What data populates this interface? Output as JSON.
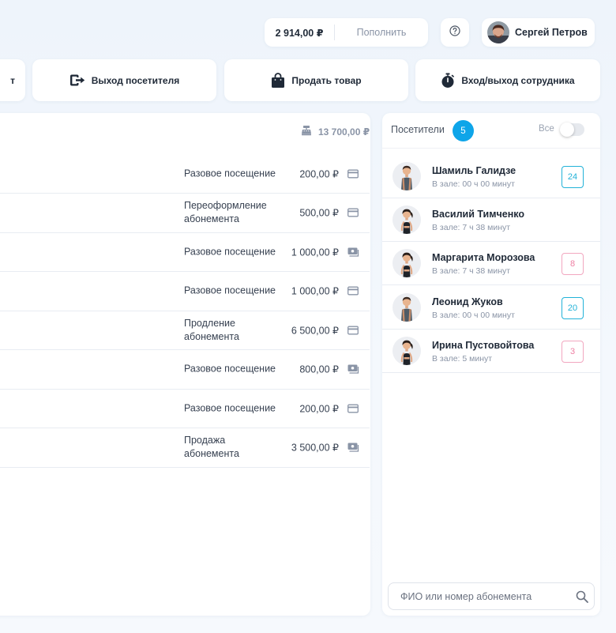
{
  "header": {
    "balance": "2 914,00 ₽",
    "topup_label": "Пополнить",
    "user_name": "Сергей Петров"
  },
  "actions": [
    {
      "label": "т",
      "icon": "partial-icon"
    },
    {
      "label": "Выход посетителя",
      "icon": "exit-icon"
    },
    {
      "label": "Продать товар",
      "icon": "shopping-bag-icon"
    },
    {
      "label": "Вход/выход сотрудника",
      "icon": "stopwatch-icon"
    }
  ],
  "transactions": {
    "total": "13 700,00 ₽",
    "total_icon": "cash-register-icon",
    "rows": [
      {
        "desc": "Разовое посещение",
        "amount": "200,00 ₽",
        "payment": "card"
      },
      {
        "desc": "Переоформление абонемента",
        "amount": "500,00 ₽",
        "payment": "card"
      },
      {
        "desc": "Разовое посещение",
        "amount": "1 000,00 ₽",
        "payment": "cash"
      },
      {
        "desc": "Разовое посещение",
        "amount": "1 000,00 ₽",
        "payment": "card"
      },
      {
        "desc": "Продление абонемента",
        "amount": "6 500,00 ₽",
        "payment": "card"
      },
      {
        "desc": "Разовое посещение",
        "amount": "800,00 ₽",
        "payment": "cash"
      },
      {
        "desc": "Разовое посещение",
        "amount": "200,00 ₽",
        "payment": "card"
      },
      {
        "desc": "Продажа абонемента",
        "amount": "3 500,00 ₽",
        "payment": "cash"
      }
    ]
  },
  "visitors": {
    "title": "Посетители",
    "count": "5",
    "filter_label": "Все",
    "filter_on": false,
    "items": [
      {
        "name": "Шамиль Галидзе",
        "time": "В зале: 00 ч 00 минут",
        "badge": "24",
        "badge_color": "blue",
        "gender": "male"
      },
      {
        "name": "Василий Тимченко",
        "time": "В зале: 7 ч 38 минут",
        "badge": "",
        "badge_color": "",
        "gender": "female"
      },
      {
        "name": "Маргарита Морозова",
        "time": "В зале: 7 ч 38 минут",
        "badge": "8",
        "badge_color": "pink",
        "gender": "female"
      },
      {
        "name": "Леонид Жуков",
        "time": "В зале: 00 ч 00 минут",
        "badge": "20",
        "badge_color": "blue",
        "gender": "male"
      },
      {
        "name": "Ирина Пустовойтова",
        "time": "В зале: 5 минут",
        "badge": "3",
        "badge_color": "pink",
        "gender": "female"
      }
    ],
    "search_placeholder": "ФИО или номер абонемента"
  },
  "colors": {
    "accent": "#0ea5e9",
    "badge_blue": "#22b2d8",
    "badge_pink": "#ee7fa3"
  }
}
